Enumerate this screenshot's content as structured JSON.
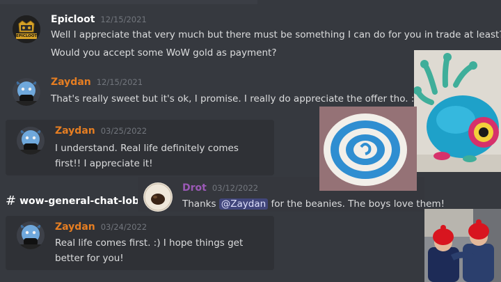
{
  "colors": {
    "background": "#36393f",
    "zaydan": "#e67e22",
    "drot": "#9b59b6",
    "epicloot": "#ffffff",
    "mention_bg": "#4a5290"
  },
  "msg_epicloot": {
    "author": "Epicloot",
    "timestamp": "12/15/2021",
    "avatar_text": "EPICLOOT",
    "lines": [
      "Well I appreciate that very much but there must be something I can do for you in trade at least?",
      "Would you accept some WoW gold as payment?"
    ]
  },
  "msg_zaydan_1": {
    "author": "Zaydan",
    "timestamp": "12/15/2021",
    "lines": [
      "That's really sweet but it's ok,  I promise. I really do appreciate the offer tho. :)"
    ]
  },
  "msg_zaydan_2": {
    "author": "Zaydan",
    "timestamp": "03/25/2022",
    "lines": [
      "I understand.  Real life definitely comes",
      "first!!  I appreciate it!"
    ]
  },
  "channel": {
    "hash": "#",
    "name": "wow-general-chat-lobby"
  },
  "msg_drot": {
    "author": "Drot",
    "timestamp": "03/12/2022",
    "text_before": "Thanks ",
    "mention": "@Zaydan",
    "text_after": " for the beanies. The boys love them!"
  },
  "msg_zaydan_3": {
    "author": "Zaydan",
    "timestamp": "03/24/2022",
    "lines": [
      "Real life comes first. :)  I hope things get",
      "better for you!"
    ]
  },
  "images": {
    "crochet_beholder": "crochet-beholder-photo",
    "crochet_coaster": "crochet-coaster-photo",
    "kids_beanies": "kids-beanies-photo"
  }
}
